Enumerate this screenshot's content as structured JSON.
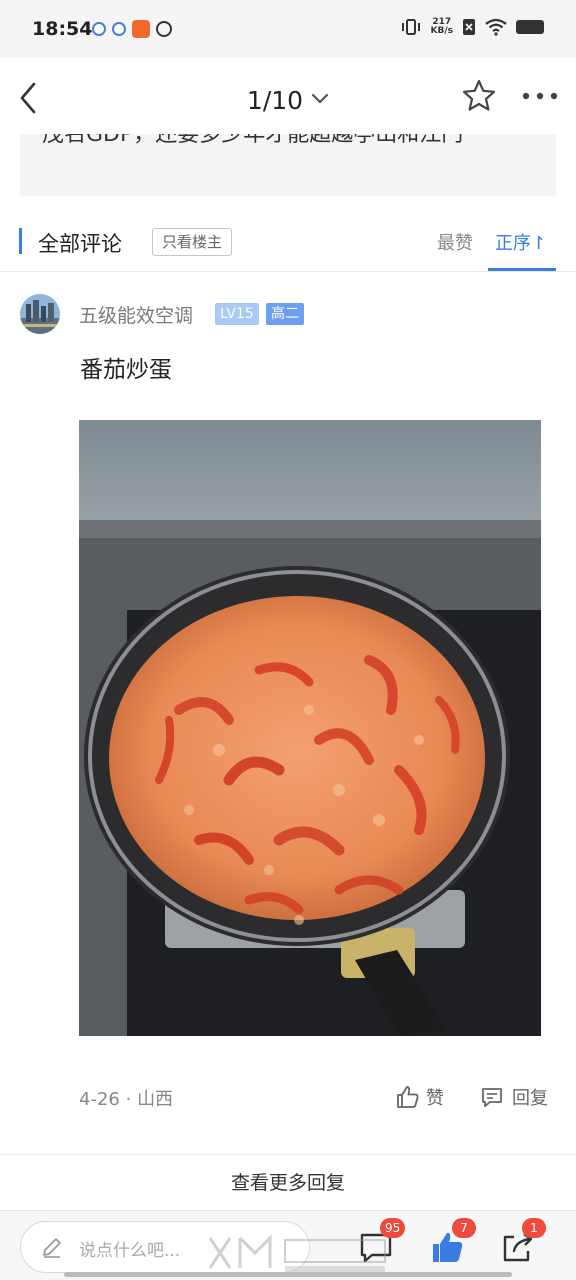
{
  "status_bar": {
    "time": "18:54",
    "net_speed_value": "217",
    "net_speed_unit": "KB/s"
  },
  "header": {
    "page_indicator": "1/10"
  },
  "quote": {
    "text": "茂名GDP，还要多少年才能超越亭山和江门"
  },
  "comments_header": {
    "title": "全部评论",
    "op_only": "只看楼主",
    "sort_hot": "最赞",
    "sort_asc": "正序↾"
  },
  "comment": {
    "username": "五级能效空调",
    "level": "LV15",
    "grade": "高二",
    "text": "番茄炒蛋",
    "date": "4-26",
    "separator": "·",
    "location": "山西",
    "like_label": "赞",
    "reply_label": "回复"
  },
  "more_replies": "查看更多回复",
  "bottom_bar": {
    "placeholder": "说点什么吧...",
    "comments_count": "95",
    "likes_count": "7",
    "share_count": "1"
  },
  "colors": {
    "accent": "#3a7be6",
    "badge_red": "#f04a3c",
    "level_badge": "#aac9f4",
    "grade_badge": "#6e9ef0"
  },
  "icons": [
    "back-icon",
    "chevron-down-icon",
    "star-icon",
    "more-icon",
    "like-icon",
    "reply-icon",
    "pencil-icon",
    "comment-icon",
    "thumbs-up-icon",
    "share-icon"
  ]
}
